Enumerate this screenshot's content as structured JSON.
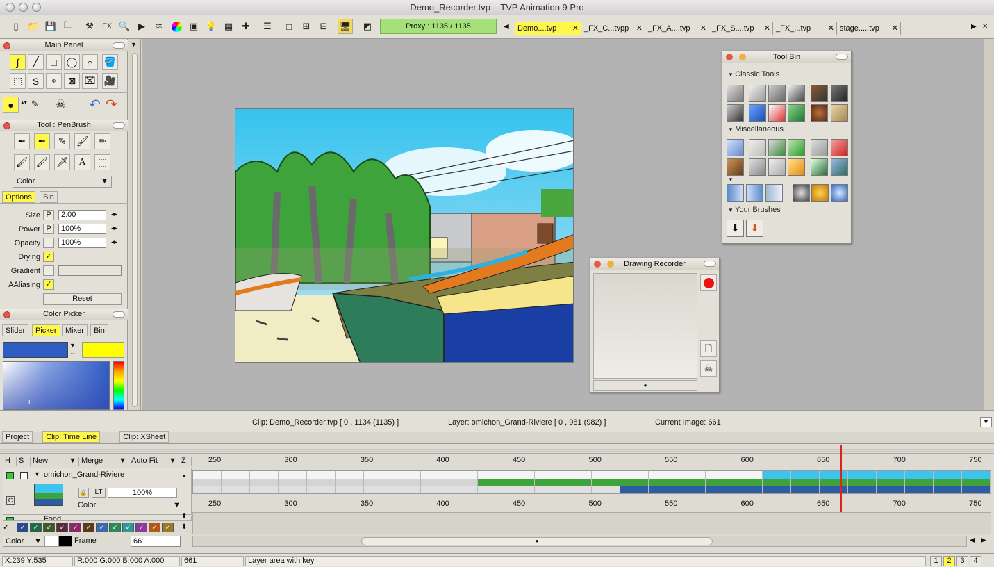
{
  "window": {
    "title": "Demo_Recorder.tvp – TVP Animation 9 Pro"
  },
  "toolbar": {
    "proxy": "Proxy : 1135 / 1135",
    "fx_label": "FX",
    "tabs": [
      {
        "label": "Demo....tvp",
        "active": true
      },
      {
        "label": "_FX_C...tvpp",
        "active": false
      },
      {
        "label": "_FX_A....tvp",
        "active": false
      },
      {
        "label": "_FX_S....tvp",
        "active": false
      },
      {
        "label": "_FX_...tvp",
        "active": false
      },
      {
        "label": "stage.....tvp",
        "active": false
      }
    ],
    "close_glyph": "✕"
  },
  "main_panel": {
    "title": "Main Panel"
  },
  "tool_panel": {
    "title": "Tool : PenBrush",
    "mode_select": "Color",
    "tabs": [
      "Options",
      "Bin"
    ],
    "options": {
      "size_label": "Size",
      "size_value": "2.00",
      "power_label": "Power",
      "power_value": "100%",
      "opacity_label": "Opacity",
      "opacity_value": "100%",
      "drying_label": "Drying",
      "gradient_label": "Gradient",
      "aaliasing_label": "AAliasing",
      "p_flag": "P",
      "check": "✓",
      "reset": "Reset"
    }
  },
  "color_picker": {
    "title": "Color Picker",
    "tabs": [
      "Slider",
      "Picker",
      "Mixer",
      "Bin"
    ],
    "colors": {
      "primary": "#2f5cc4",
      "secondary": "#ffff00"
    }
  },
  "tool_bin": {
    "title": "Tool Bin",
    "sections": [
      "Classic Tools",
      "Miscellaneous",
      "Your Brushes"
    ]
  },
  "drawing_recorder": {
    "title": "Drawing Recorder"
  },
  "info": {
    "clip": "Clip: Demo_Recorder.tvp [ 0 , 1134  (1135) ]",
    "layer": "Layer: omichon_Grand-Riviere [ 0 , 981  (982) ]",
    "current": "Current Image: 661"
  },
  "bottom_tabs": [
    {
      "label": "Project",
      "active": false
    },
    {
      "label": "Clip: Time Line",
      "active": true
    },
    {
      "label": "Clip: XSheet",
      "active": false
    }
  ],
  "timeline": {
    "headers": {
      "h": "H",
      "s": "S",
      "new": "New",
      "merge": "Merge",
      "autofit": "Auto Fit",
      "z": "Z"
    },
    "ticks": [
      "250",
      "300",
      "350",
      "400",
      "450",
      "500",
      "550",
      "600",
      "650",
      "700",
      "750"
    ],
    "layer": {
      "name": "omichon_Grand-Riviere",
      "opacity": "100%",
      "mode": "Color",
      "lt": "LT",
      "c_flag": "C"
    },
    "layer2": {
      "name": "Fond"
    },
    "footer": {
      "mode": "Color",
      "frame_label": "Frame",
      "frame_value": "661"
    },
    "current_frame": 661,
    "range": [
      235,
      760
    ]
  },
  "status": {
    "coords": "X:239  Y:535",
    "rgba": "R:000 G:000 B:000 A:000",
    "frame": "661",
    "hint": "Layer area with key",
    "pages": [
      "1",
      "2",
      "3",
      "4"
    ],
    "active_page": "2"
  }
}
